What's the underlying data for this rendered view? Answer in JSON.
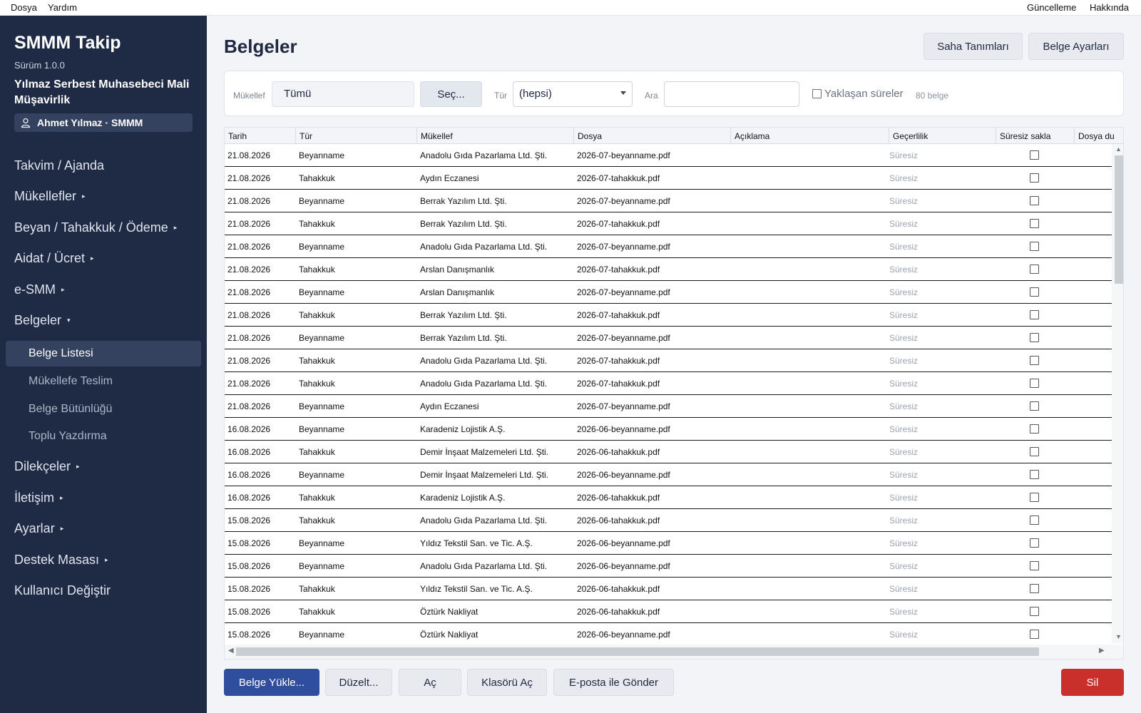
{
  "menubar": {
    "left": [
      "Dosya",
      "Yardım"
    ],
    "right": [
      "Güncelleme",
      "Hakkında"
    ]
  },
  "sidebar": {
    "app_title": "SMMM Takip",
    "version": "Sürüm 1.0.0",
    "company": "Yılmaz Serbest Muhasebeci Mali Müşavirlik",
    "user": "Ahmet Yılmaz · SMMM",
    "nav_top": [
      {
        "label": "Takvim / Ajanda",
        "arrow": ""
      },
      {
        "label": "Mükellefler",
        "arrow": "▸"
      },
      {
        "label": "Beyan / Tahakkuk / Ödeme",
        "arrow": "▸"
      },
      {
        "label": "Aidat / Ücret",
        "arrow": "▸"
      },
      {
        "label": "e-SMM",
        "arrow": "▸"
      },
      {
        "label": "Belgeler",
        "arrow": "▾"
      }
    ],
    "sub_items": [
      {
        "label": "Belge Listesi",
        "active": true
      },
      {
        "label": "Mükellefe Teslim",
        "active": false
      },
      {
        "label": "Belge Bütünlüğü",
        "active": false
      },
      {
        "label": "Toplu Yazdırma",
        "active": false
      }
    ],
    "nav_bottom": [
      {
        "label": "Dilekçeler",
        "arrow": "▸"
      },
      {
        "label": "İletişim",
        "arrow": "▸"
      },
      {
        "label": "Ayarlar",
        "arrow": "▸"
      },
      {
        "label": "Destek Masası",
        "arrow": "▸"
      },
      {
        "label": "Kullanıcı Değiştir",
        "arrow": ""
      }
    ]
  },
  "header": {
    "title": "Belgeler",
    "buttons": [
      "Saha Tanımları",
      "Belge Ayarları"
    ]
  },
  "filter": {
    "mukellef_label": "Mükellef",
    "mukellef_value": "Tümü",
    "select_button": "Seç...",
    "type_label": "Tür",
    "type_value": "(hepsi)",
    "search_label": "Ara",
    "search_value": "",
    "upcoming_label": "Yaklaşan süreler",
    "upcoming_checked": false,
    "count": "80 belge"
  },
  "table": {
    "columns": [
      "Tarih",
      "Tür",
      "Mükellef",
      "Dosya",
      "Açıklama",
      "Geçerlilik",
      "Süresiz sakla",
      "Dosya du"
    ],
    "rows": [
      [
        "21.08.2026",
        "Beyanname",
        "Anadolu Gıda Pazarlama Ltd. Şti.",
        "2026-07-beyanname.pdf",
        "",
        "Süresiz"
      ],
      [
        "21.08.2026",
        "Tahakkuk",
        "Aydın Eczanesi",
        "2026-07-tahakkuk.pdf",
        "",
        "Süresiz"
      ],
      [
        "21.08.2026",
        "Beyanname",
        "Berrak Yazılım Ltd. Şti.",
        "2026-07-beyanname.pdf",
        "",
        "Süresiz"
      ],
      [
        "21.08.2026",
        "Tahakkuk",
        "Berrak Yazılım Ltd. Şti.",
        "2026-07-tahakkuk.pdf",
        "",
        "Süresiz"
      ],
      [
        "21.08.2026",
        "Beyanname",
        "Anadolu Gıda Pazarlama Ltd. Şti.",
        "2026-07-beyanname.pdf",
        "",
        "Süresiz"
      ],
      [
        "21.08.2026",
        "Tahakkuk",
        "Arslan Danışmanlık",
        "2026-07-tahakkuk.pdf",
        "",
        "Süresiz"
      ],
      [
        "21.08.2026",
        "Beyanname",
        "Arslan Danışmanlık",
        "2026-07-beyanname.pdf",
        "",
        "Süresiz"
      ],
      [
        "21.08.2026",
        "Tahakkuk",
        "Berrak Yazılım Ltd. Şti.",
        "2026-07-tahakkuk.pdf",
        "",
        "Süresiz"
      ],
      [
        "21.08.2026",
        "Beyanname",
        "Berrak Yazılım Ltd. Şti.",
        "2026-07-beyanname.pdf",
        "",
        "Süresiz"
      ],
      [
        "21.08.2026",
        "Tahakkuk",
        "Anadolu Gıda Pazarlama Ltd. Şti.",
        "2026-07-tahakkuk.pdf",
        "",
        "Süresiz"
      ],
      [
        "21.08.2026",
        "Tahakkuk",
        "Anadolu Gıda Pazarlama Ltd. Şti.",
        "2026-07-tahakkuk.pdf",
        "",
        "Süresiz"
      ],
      [
        "21.08.2026",
        "Beyanname",
        "Aydın Eczanesi",
        "2026-07-beyanname.pdf",
        "",
        "Süresiz"
      ],
      [
        "16.08.2026",
        "Beyanname",
        "Karadeniz Lojistik A.Ş.",
        "2026-06-beyanname.pdf",
        "",
        "Süresiz"
      ],
      [
        "16.08.2026",
        "Tahakkuk",
        "Demir İnşaat Malzemeleri Ltd. Şti.",
        "2026-06-tahakkuk.pdf",
        "",
        "Süresiz"
      ],
      [
        "16.08.2026",
        "Beyanname",
        "Demir İnşaat Malzemeleri Ltd. Şti.",
        "2026-06-beyanname.pdf",
        "",
        "Süresiz"
      ],
      [
        "16.08.2026",
        "Tahakkuk",
        "Karadeniz Lojistik A.Ş.",
        "2026-06-tahakkuk.pdf",
        "",
        "Süresiz"
      ],
      [
        "15.08.2026",
        "Tahakkuk",
        "Anadolu Gıda Pazarlama Ltd. Şti.",
        "2026-06-tahakkuk.pdf",
        "",
        "Süresiz"
      ],
      [
        "15.08.2026",
        "Beyanname",
        "Yıldız Tekstil San. ve Tic. A.Ş.",
        "2026-06-beyanname.pdf",
        "",
        "Süresiz"
      ],
      [
        "15.08.2026",
        "Beyanname",
        "Anadolu Gıda Pazarlama Ltd. Şti.",
        "2026-06-beyanname.pdf",
        "",
        "Süresiz"
      ],
      [
        "15.08.2026",
        "Tahakkuk",
        "Yıldız Tekstil San. ve Tic. A.Ş.",
        "2026-06-tahakkuk.pdf",
        "",
        "Süresiz"
      ],
      [
        "15.08.2026",
        "Tahakkuk",
        "Öztürk Nakliyat",
        "2026-06-tahakkuk.pdf",
        "",
        "Süresiz"
      ],
      [
        "15.08.2026",
        "Beyanname",
        "Öztürk Nakliyat",
        "2026-06-beyanname.pdf",
        "",
        "Süresiz"
      ]
    ]
  },
  "actions": {
    "left": [
      "Belge Yükle...",
      "Düzelt...",
      "Aç",
      "Klasörü Aç",
      "E-posta ile Gönder"
    ],
    "delete": "Sil"
  },
  "colors": {
    "sidebar_bg": "#1f2a45",
    "primary": "#2f4f9e",
    "danger": "#c9302c",
    "validity_text": "#9aa3b5"
  },
  "icons": {
    "user": "user-icon",
    "dropdown": "chevron-down-icon",
    "nav_arrow": "chevron-right-icon"
  }
}
